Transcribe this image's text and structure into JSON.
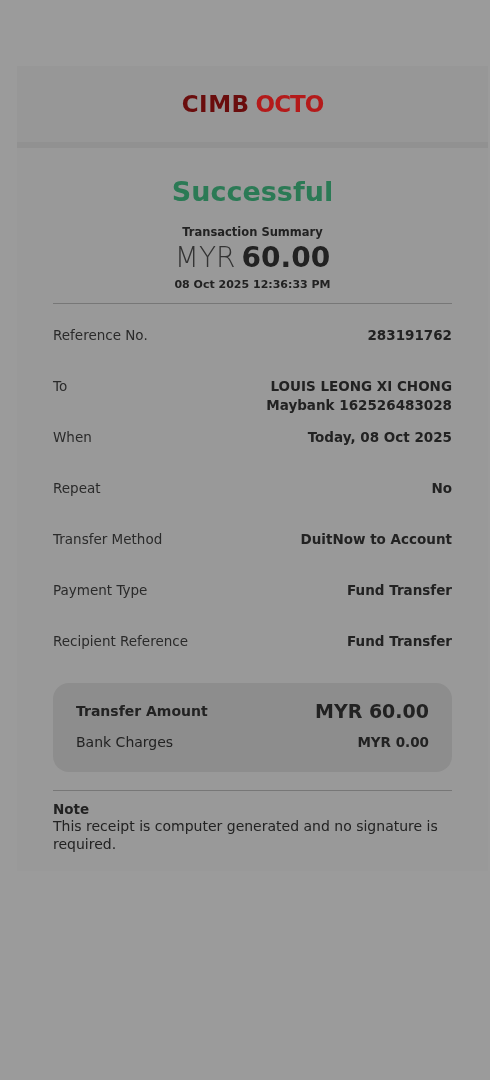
{
  "logo": {
    "primary": "CIMB",
    "secondary": "OCTO"
  },
  "status": "Successful",
  "summary": {
    "title": "Transaction Summary",
    "currency": "MYR",
    "amount": "60.00",
    "datetime": "08 Oct 2025 12:36:33 PM"
  },
  "details": [
    {
      "label": "Reference No.",
      "value": [
        "283191762"
      ]
    },
    {
      "label": "To",
      "value": [
        "LOUIS LEONG XI CHONG",
        "Maybank 162526483028"
      ]
    },
    {
      "label": "When",
      "value": [
        "Today, 08 Oct 2025"
      ]
    },
    {
      "label": "Repeat",
      "value": [
        "No"
      ]
    },
    {
      "label": "Transfer Method",
      "value": [
        "DuitNow to Account"
      ]
    },
    {
      "label": "Payment Type",
      "value": [
        "Fund Transfer"
      ]
    },
    {
      "label": "Recipient Reference",
      "value": [
        "Fund Transfer"
      ]
    }
  ],
  "totals": [
    {
      "kind": "main",
      "label": "Transfer Amount",
      "value": "MYR 60.00"
    },
    {
      "kind": "sub",
      "label": "Bank Charges",
      "value": "MYR 0.00"
    }
  ],
  "note": {
    "title": "Note",
    "text": "This receipt is computer generated and no signature is required."
  }
}
